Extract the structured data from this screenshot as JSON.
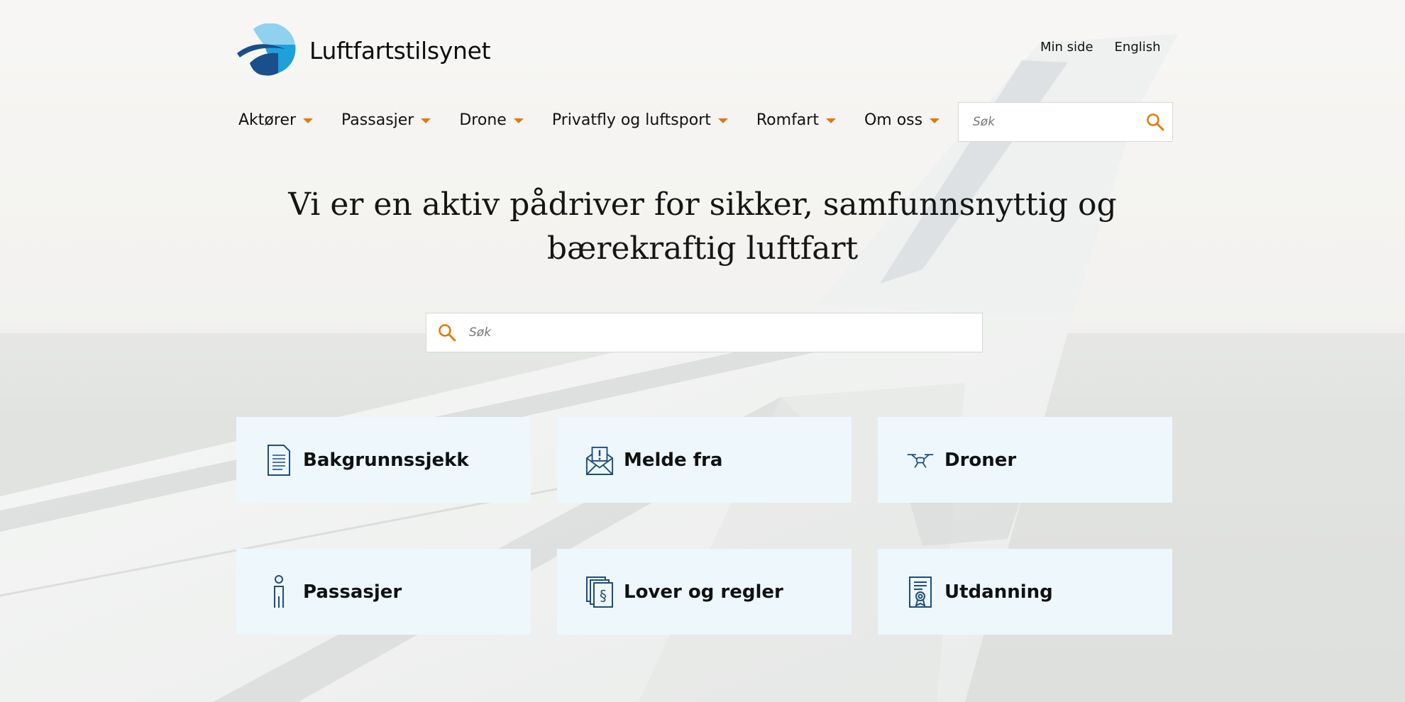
{
  "brand": {
    "name": "Luftfartstilsynet",
    "logo_icon": "logo-icon"
  },
  "top_links": {
    "my_page": "Min side",
    "english": "English"
  },
  "nav": {
    "items": [
      {
        "label": "Aktører"
      },
      {
        "label": "Passasjer"
      },
      {
        "label": "Drone"
      },
      {
        "label": "Privatfly og luftsport"
      },
      {
        "label": "Romfart"
      },
      {
        "label": "Om oss"
      }
    ],
    "search_placeholder": "Søk"
  },
  "hero": {
    "heading_line1": "Vi er en aktiv pådriver for sikker, samfunnsnyttig og",
    "heading_line2": "bærekraftig luftfart"
  },
  "main_search": {
    "placeholder": "Søk"
  },
  "tiles": [
    {
      "label": "Bakgrunnssjekk",
      "icon": "document-icon"
    },
    {
      "label": "Melde fra",
      "icon": "envelope-alert-icon"
    },
    {
      "label": "Droner",
      "icon": "drone-icon"
    },
    {
      "label": "Passasjer",
      "icon": "person-icon"
    },
    {
      "label": "Lover og regler",
      "icon": "paragraph-docs-icon"
    },
    {
      "label": "Utdanning",
      "icon": "certificate-icon"
    }
  ],
  "colors": {
    "accent": "#e07a10",
    "tile_bg": "#edf7fc",
    "icon_blue": "#1f4e79",
    "logo_light": "#4fb3e6",
    "logo_dark": "#1a4f8b"
  }
}
